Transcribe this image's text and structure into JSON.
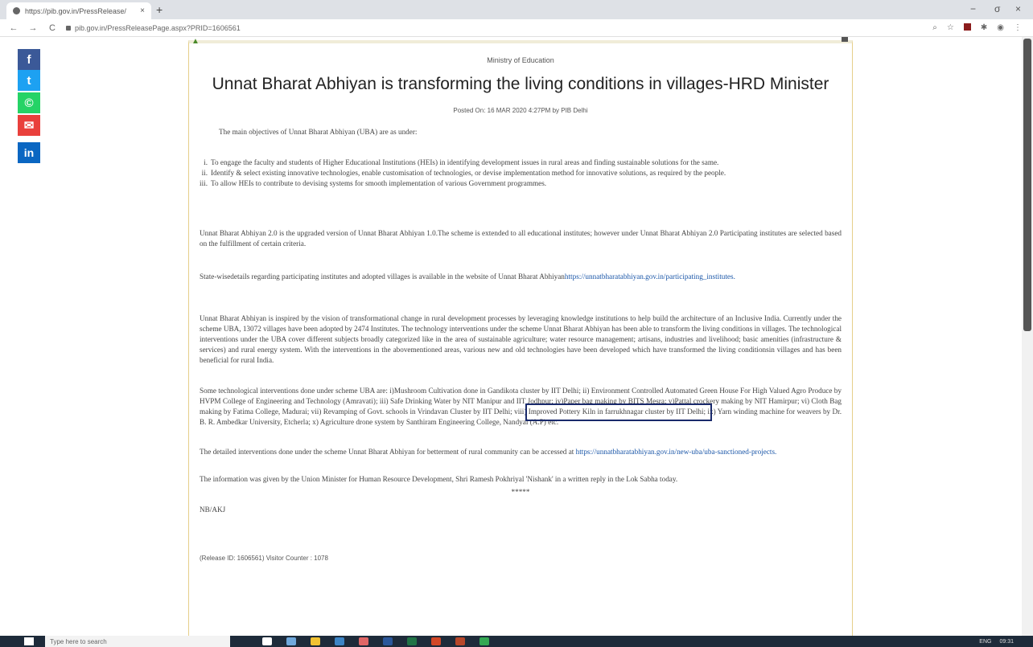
{
  "browser": {
    "tab_title": "https://pib.gov.in/PressRelease/",
    "tab_close": "×",
    "new_tab": "+",
    "url": "pib.gov.in/PressReleasePage.aspx?PRID=1606561",
    "nav": {
      "back": "←",
      "forward": "→",
      "reload": "C"
    },
    "window": {
      "minimize": "−",
      "maximize": "σ",
      "close": "×"
    }
  },
  "share": {
    "facebook": "f",
    "twitter": "t",
    "whatsapp": "©",
    "email": "✉",
    "linkedin": "in"
  },
  "press": {
    "ministry": "Ministry of Education",
    "headline": "Unnat Bharat Abhiyan is transforming the living conditions in villages-HRD Minister",
    "posted": "Posted On: 16 MAR 2020 4:27PM by PIB Delhi",
    "objectives_intro": "The main objectives of Unnat Bharat Abhiyan (UBA) are as under:",
    "objectives": [
      {
        "num": "i.",
        "text": "To engage the faculty and students of Higher Educational Institutions (HEIs) in identifying development issues in rural areas and finding sustainable solutions for the same."
      },
      {
        "num": "ii.",
        "text": "Identify & select existing innovative technologies, enable customisation of technologies, or devise implementation method for innovative solutions, as required by the people."
      },
      {
        "num": "iii.",
        "text": "To allow HEIs to contribute to devising systems for smooth implementation of various Government programmes."
      }
    ],
    "uba20": "Unnat Bharat Abhiyan 2.0 is the upgraded version of Unnat Bharat Abhiyan 1.0.The scheme is extended to all educational institutes; however under Unnat Bharat Abhiyan 2.0 Participating institutes are selected based on the fulfillment of certain criteria.",
    "state_text": "State-wisedetails regarding participating institutes and adopted villages is available in the website of Unnat Bharat Abhiyan",
    "state_link": "https://unnatbharatabhiyan.gov.in/participating_institutes.",
    "inspired": "Unnat Bharat Abhiyan is inspired by the vision of transformational change in rural development processes by leveraging knowledge institutions to help build the architecture of an Inclusive India. Currently under the scheme UBA, 13072 villages have been adopted by 2474 Institutes. The technology interventions under the scheme Unnat Bharat Abhiyan has been able to transform the living conditions in villages. The technological interventions under the UBA cover different subjects broadly categorized like in the area of sustainable agriculture; water resource management; artisans, industries and livelihood; basic amenities (infrastructure & services) and rural energy system. With the interventions in the abovementioned areas, various new and old technologies have been developed which have transformed the living conditionsin villages and has been beneficial for rural India.",
    "tech": "Some technological interventions done under scheme UBA are: i)Mushroom Cultivation done in Gandikota cluster by IIT Delhi; ii) Environment Controlled Automated Green House For High Valued Agro Produce by HVPM College of Engineering and Technology (Amravati); iii) Safe Drinking Water by NIT Manipur and IIT Jodhpur; iv)Paper bag making by BITS Mesra; v)Pattal crockery making by NIT Hamirpur; vi) Cloth Bag making by Fatima College, Madurai; vii) Revamping of Govt. schools in Vrindavan Cluster by IIT Delhi; viii) Improved Pottery Kiln in farrukhnagar cluster by IIT Delhi; ix) Yarn winding machine for weavers by Dr. B. R. Ambedkar University, Etcherla; x) Agriculture drone system by Santhiram Engineering College, Nandyal (A.P) etc.",
    "detailed_text": "The detailed interventions done under the scheme Unnat Bharat Abhiyan for betterment of rural community can be accessed at",
    "detailed_link": "https://unnatbharatabhiyan.gov.in/new-uba/uba-sanctioned-projects.",
    "info": "The information was given by the Union Minister for Human Resource Development, Shri Ramesh Pokhriyal 'Nishank' in a written reply in the Lok Sabha today.",
    "stars": "*****",
    "signoff": "NB/AKJ",
    "release": "(Release ID: 1606561) Visitor Counter : 1078"
  },
  "taskbar": {
    "search_placeholder": "Type here to search",
    "lang": "ENG",
    "time": "09:31"
  }
}
